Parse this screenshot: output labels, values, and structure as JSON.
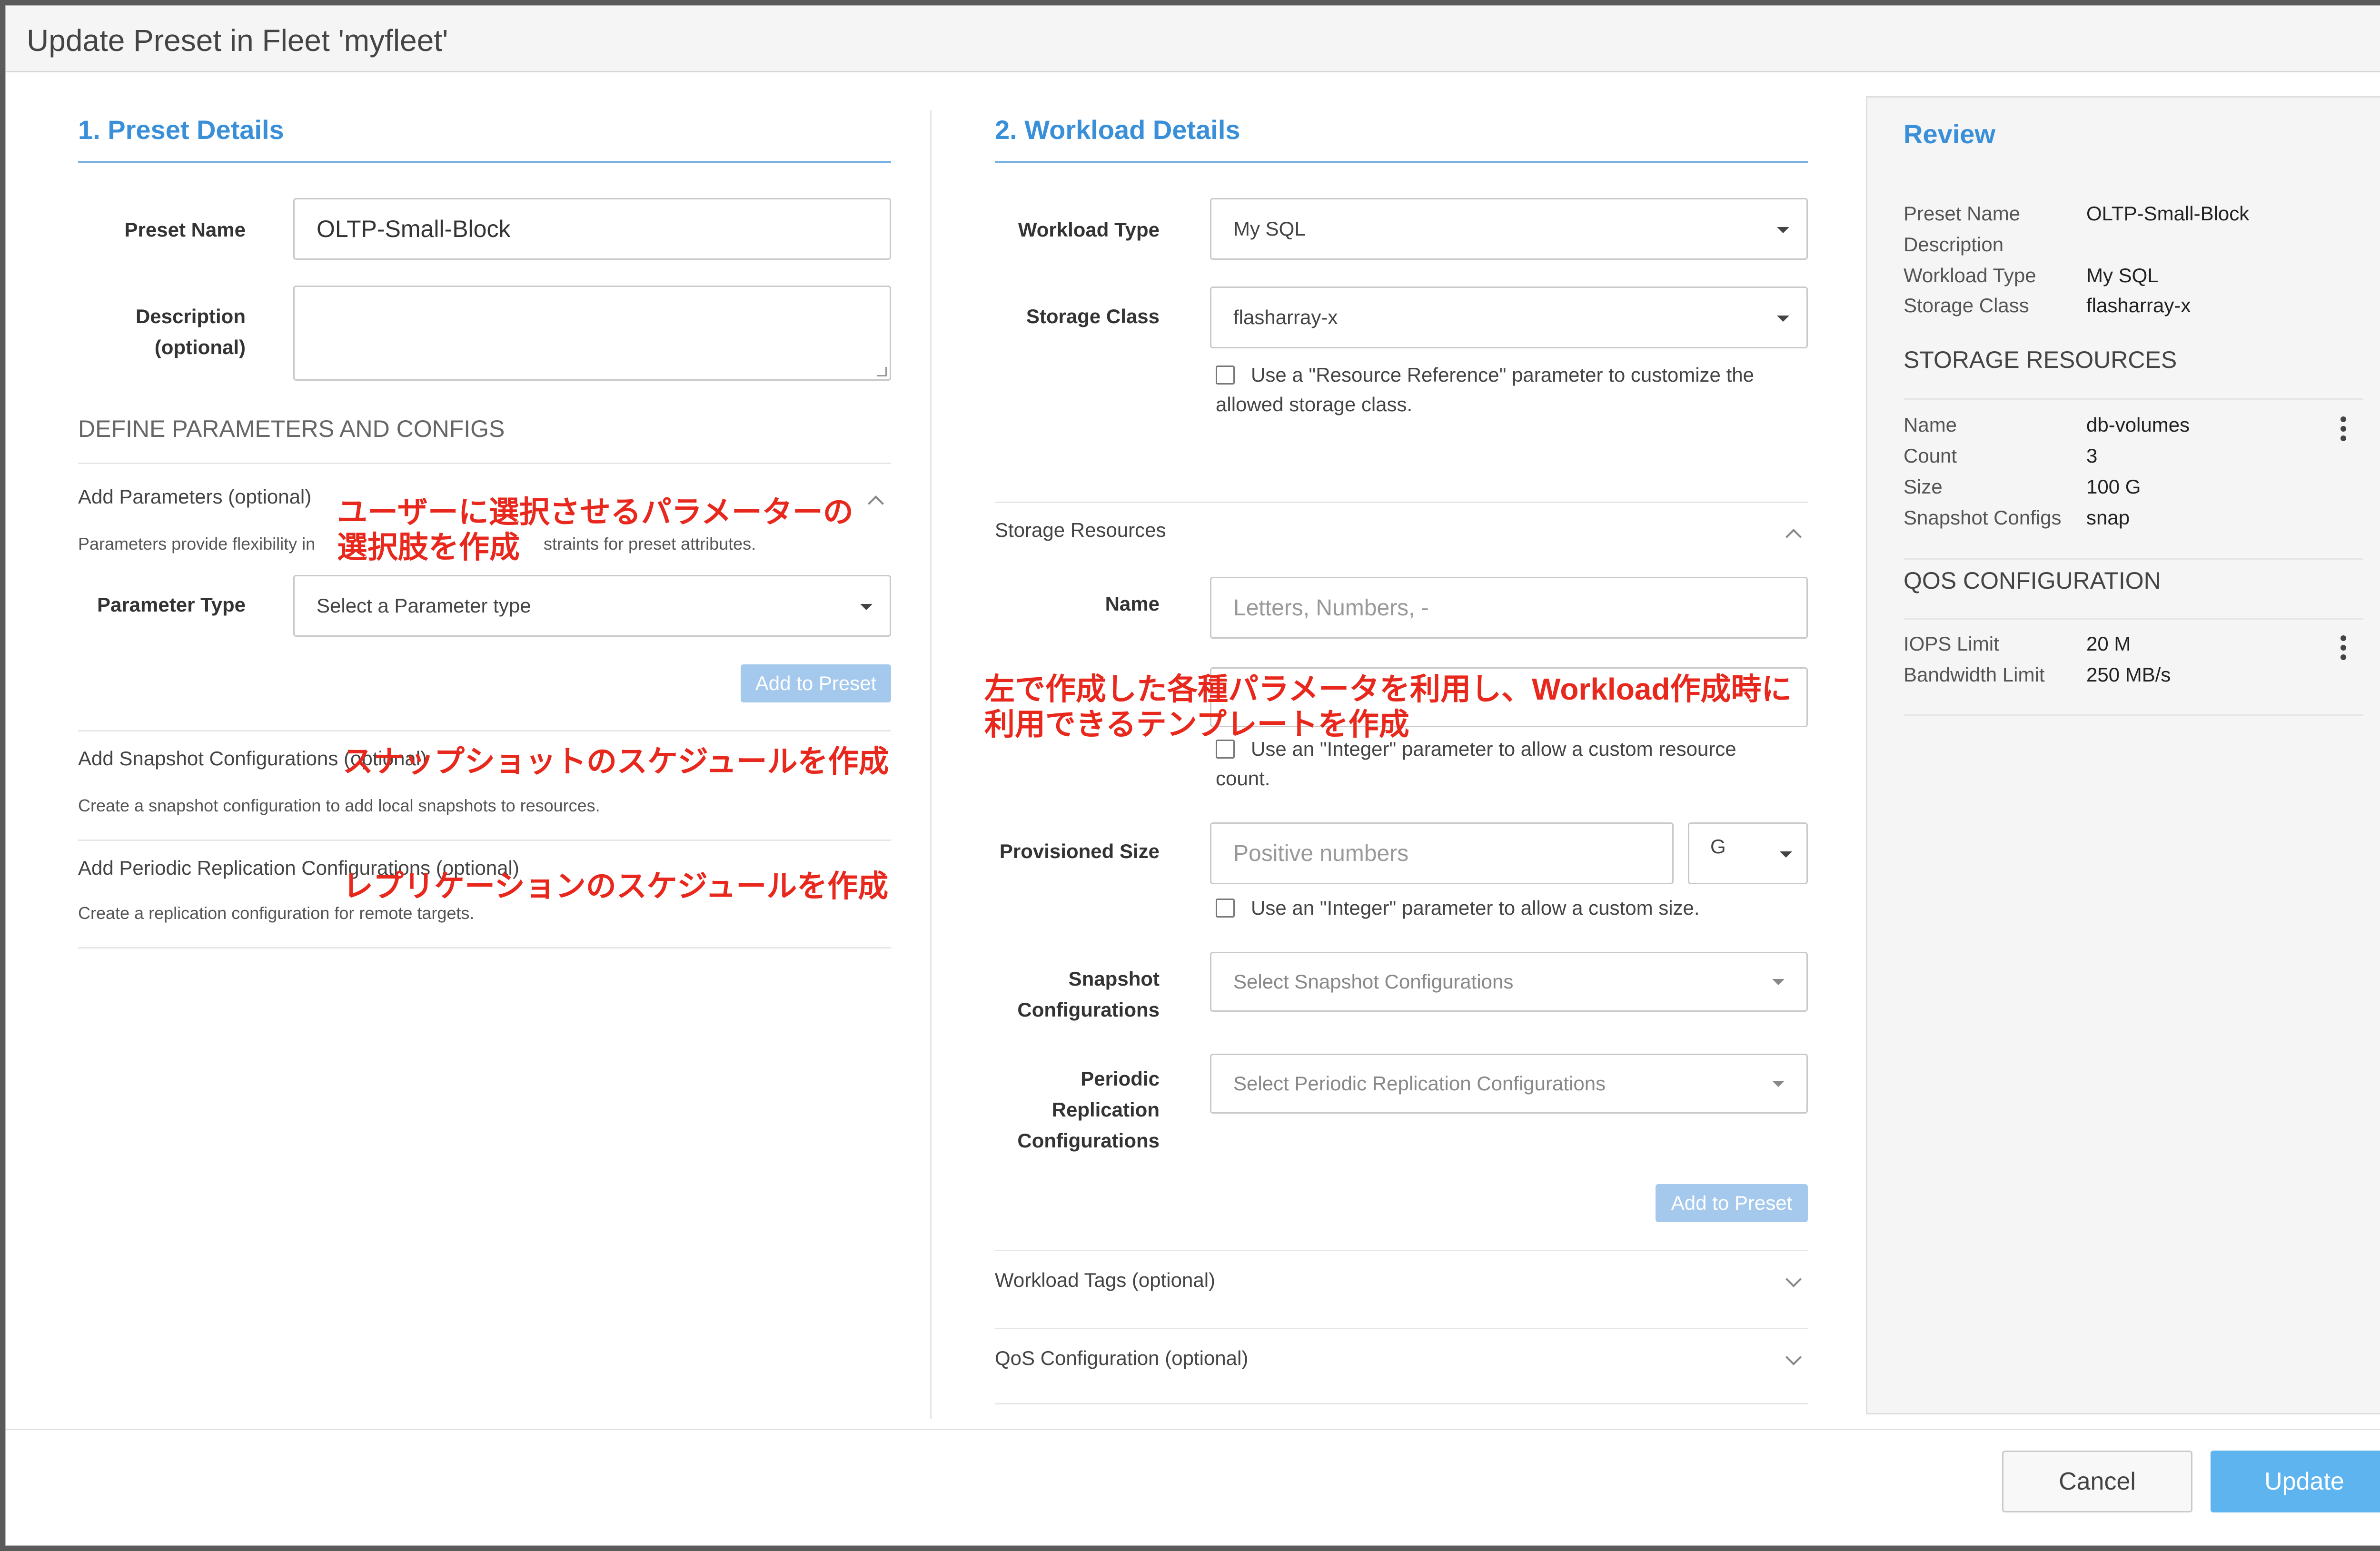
{
  "dialog": {
    "title": "Update Preset in Fleet 'myfleet'"
  },
  "preset_details": {
    "heading": "1. Preset Details",
    "preset_name_label": "Preset Name",
    "preset_name_value": "OLTP-Small-Block",
    "description_label_1": "Description",
    "description_label_2": "(optional)",
    "description_value": "",
    "define_heading": "DEFINE PARAMETERS AND CONFIGS",
    "add_parameters_title": "Add Parameters (optional)",
    "add_parameters_desc_a": "Parameters provide flexibility in",
    "add_parameters_desc_b": "straints for preset attributes.",
    "parameter_type_label": "Parameter Type",
    "parameter_type_placeholder": "Select a Parameter type",
    "add_to_preset": "Add to Preset",
    "snapshot_title": "Add Snapshot Configurations (optional)",
    "snapshot_desc": "Create a snapshot configuration to add local snapshots to resources.",
    "replication_title": "Add Periodic Replication Configurations (optional)",
    "replication_desc": "Create a replication configuration for remote targets."
  },
  "workload_details": {
    "heading": "2. Workload Details",
    "workload_type_label": "Workload Type",
    "workload_type_value": "My SQL",
    "storage_class_label": "Storage Class",
    "storage_class_value": "flasharray-x",
    "resource_ref_line1": "Use a \"Resource Reference\" parameter to customize the",
    "resource_ref_line2": "allowed storage class.",
    "storage_resources_title": "Storage Resources",
    "name_label": "Name",
    "name_placeholder": "Letters, Numbers, -",
    "count_line1": "Use an \"Integer\" parameter to allow a custom resource",
    "count_line2": "count.",
    "provisioned_size_label": "Provisioned Size",
    "provisioned_size_placeholder": "Positive numbers",
    "size_unit": "G",
    "size_checkbox": "Use an \"Integer\" parameter to allow a custom size.",
    "snapshot_label_1": "Snapshot",
    "snapshot_label_2": "Configurations",
    "snapshot_placeholder": "Select Snapshot Configurations",
    "periodic_label_1": "Periodic",
    "periodic_label_2": "Replication",
    "periodic_label_3": "Configurations",
    "periodic_placeholder": "Select Periodic Replication Configurations",
    "add_to_preset": "Add to Preset",
    "workload_tags_title": "Workload Tags (optional)",
    "qos_title": "QoS Configuration (optional)"
  },
  "review": {
    "heading": "Review",
    "rows": [
      {
        "k": "Preset Name",
        "v": "OLTP-Small-Block"
      },
      {
        "k": "Description",
        "v": ""
      },
      {
        "k": "Workload Type",
        "v": "My SQL"
      },
      {
        "k": "Storage Class",
        "v": "flasharray-x"
      }
    ],
    "storage_heading": "STORAGE RESOURCES",
    "storage_rows": [
      {
        "k": "Name",
        "v": "db-volumes"
      },
      {
        "k": "Count",
        "v": "3"
      },
      {
        "k": "Size",
        "v": "100 G"
      },
      {
        "k": "Snapshot Configs",
        "v": "snap"
      }
    ],
    "qos_heading": "QOS CONFIGURATION",
    "qos_rows": [
      {
        "k": "IOPS Limit",
        "v": "20 M"
      },
      {
        "k": "Bandwidth Limit",
        "v": "250 MB/s"
      }
    ]
  },
  "annotations": {
    "params_1": "ユーザーに選択させるパラメーターの",
    "params_2": "選択肢を作成",
    "snapshot": "スナップショットのスケジュールを作成",
    "replication": "レプリケーションのスケジュールを作成",
    "workload_1": "左で作成した各種パラメータを利用し、Workload作成時に",
    "workload_2": "利用できるテンプレートを作成"
  },
  "footer": {
    "cancel": "Cancel",
    "update": "Update"
  }
}
